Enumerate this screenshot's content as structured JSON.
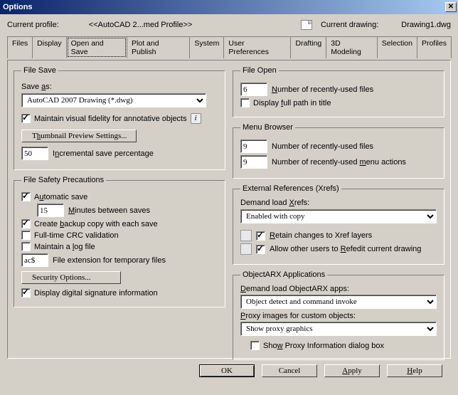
{
  "title": "Options",
  "profile": {
    "label": "Current profile:",
    "value": "<<AutoCAD 2...med Profile>>",
    "drawingLabel": "Current drawing:",
    "drawingValue": "Drawing1.dwg"
  },
  "tabs": [
    "Files",
    "Display",
    "Open and Save",
    "Plot and Publish",
    "System",
    "User Preferences",
    "Drafting",
    "3D Modeling",
    "Selection",
    "Profiles"
  ],
  "activeTab": 2,
  "fileSave": {
    "legend": "File Save",
    "saveAsLabelPre": "Save",
    "saveAsLabelU": "a",
    "saveAsLabelPost": "s:",
    "saveAsValue": "AutoCAD 2007 Drawing (*.dwg)",
    "fidelity": "Maintain visual fidelity for annotative objects",
    "thumbPre": "T",
    "thumbU": "h",
    "thumbPost": "umbnail Preview Settings...",
    "incrValue": "50",
    "incrPre": "I",
    "incrU": "n",
    "incrPost": "cremental save percentage"
  },
  "safety": {
    "legend": "File Safety Precautions",
    "autoPre": "A",
    "autoU": "u",
    "autoPost": "tomatic save",
    "minutesValue": "15",
    "minutesPre": "",
    "minutesU": "M",
    "minutesPost": "inutes between saves",
    "backupPre": "Create ",
    "backupU": "b",
    "backupPost": "ackup copy with each save",
    "crc": "Full-time CRC validation",
    "logPre": "Maintain a ",
    "logU": "l",
    "logPost": "og file",
    "extValue": "ac$",
    "extLabel": "File extension for temporary files",
    "secBtn": "Security Options...",
    "digSig": "Display digital signature information"
  },
  "fileOpen": {
    "legend": "File Open",
    "numValue": "6",
    "numPre": "",
    "numU": "N",
    "numPost": "umber of recently-used files",
    "fullPathPre": "Display ",
    "fullPathU": "f",
    "fullPathPost": "ull path in title"
  },
  "menuBrowser": {
    "legend": "Menu Browser",
    "filesValue": "9",
    "filesLabel": "Number of recently-used files",
    "actionsValue": "9",
    "actionsPre": "Number of recently-used ",
    "actionsU": "m",
    "actionsPost": "enu actions"
  },
  "xrefs": {
    "legend": "External References (Xrefs)",
    "demandPre": "Demand load ",
    "demandU": "X",
    "demandPost": "refs:",
    "value": "Enabled with copy",
    "retainPre": "",
    "retainU": "R",
    "retainPost": "etain changes to Xref layers",
    "allowPre": "Allow other users to ",
    "allowU": "R",
    "allowPost": "efedit current drawing"
  },
  "arx": {
    "legend": "ObjectARX Applications",
    "demandPre": "",
    "demandU": "D",
    "demandPost": "emand load ObjectARX apps:",
    "demandValue": "Object detect and command invoke",
    "proxyPre": "",
    "proxyU": "P",
    "proxyPost": "roxy images for custom objects:",
    "proxyValue": "Show proxy graphics",
    "showDlgPre": "Sho",
    "showDlgU": "w",
    "showDlgPost": " Proxy Information dialog box"
  },
  "buttons": {
    "ok": "OK",
    "cancel": "Cancel",
    "applyPre": "",
    "applyU": "A",
    "applyPost": "pply",
    "helpPre": "",
    "helpU": "H",
    "helpPost": "elp"
  }
}
